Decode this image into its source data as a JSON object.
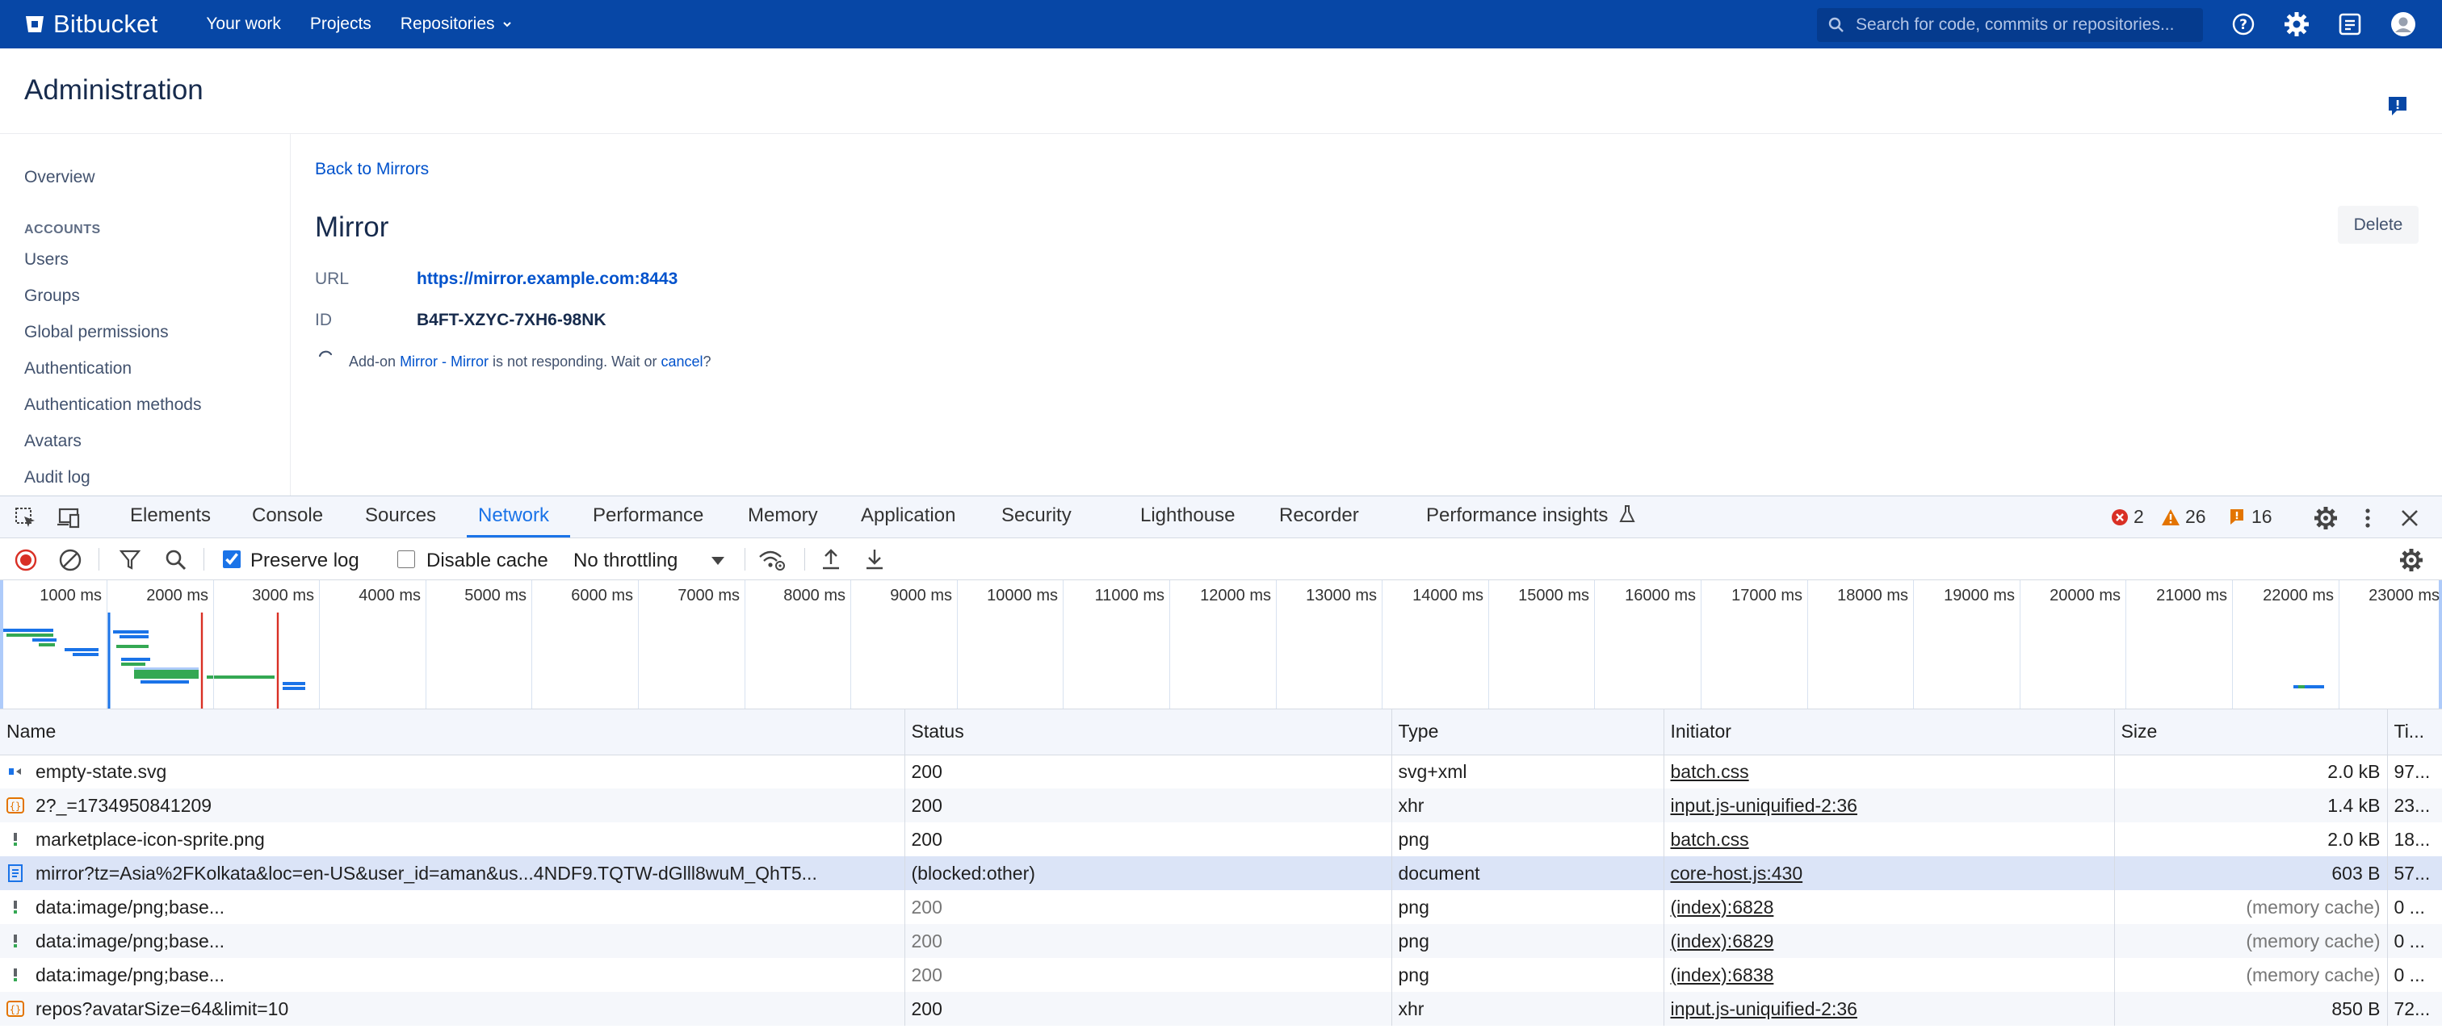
{
  "topnav": {
    "brand": "Bitbucket",
    "links": [
      "Your work",
      "Projects",
      "Repositories"
    ],
    "search_placeholder": "Search for code, commits or repositories..."
  },
  "admin": {
    "title": "Administration"
  },
  "sidebar": {
    "overview": "Overview",
    "accounts_heading": "ACCOUNTS",
    "items": [
      "Users",
      "Groups",
      "Global permissions",
      "Authentication",
      "Authentication methods",
      "Avatars",
      "Audit log"
    ]
  },
  "main": {
    "back_link": "Back to Mirrors",
    "title": "Mirror",
    "delete_label": "Delete",
    "url_label": "URL",
    "url_value": "https://mirror.example.com:8443",
    "id_label": "ID",
    "id_value": "B4FT-XZYC-7XH6-98NK",
    "addon_prefix": "Add-on",
    "addon_link": "Mirror - Mirror",
    "addon_middle": "is not responding. Wait or",
    "addon_cancel": "cancel",
    "addon_suffix": "?"
  },
  "devtools": {
    "tabs": [
      "Elements",
      "Console",
      "Sources",
      "Network",
      "Performance",
      "Memory",
      "Application",
      "Security",
      "Lighthouse",
      "Recorder",
      "Performance insights"
    ],
    "active_tab": "Network",
    "errors": "2",
    "warnings": "26",
    "issues": "16",
    "toolbar": {
      "preserve_log": "Preserve log",
      "preserve_log_checked": true,
      "disable_cache": "Disable cache",
      "disable_cache_checked": false,
      "throttling": "No throttling"
    },
    "timeline_ticks": [
      "1000 ms",
      "2000 ms",
      "3000 ms",
      "4000 ms",
      "5000 ms",
      "6000 ms",
      "7000 ms",
      "8000 ms",
      "9000 ms",
      "10000 ms",
      "11000 ms",
      "12000 ms",
      "13000 ms",
      "14000 ms",
      "15000 ms",
      "16000 ms",
      "17000 ms",
      "18000 ms",
      "19000 ms",
      "20000 ms",
      "21000 ms",
      "22000 ms",
      "23000 ms"
    ],
    "columns": [
      "Name",
      "Status",
      "Type",
      "Initiator",
      "Size",
      "Ti..."
    ],
    "rows": [
      {
        "icon": "svg",
        "name": "empty-state.svg",
        "status": "200",
        "type": "svg+xml",
        "initiator": "batch.css",
        "size": "2.0 kB",
        "time": "97..."
      },
      {
        "icon": "xhr",
        "name": "2?_=1734950841209",
        "status": "200",
        "type": "xhr",
        "initiator": "input.js-uniquified-2:36",
        "size": "1.4 kB",
        "time": "23..."
      },
      {
        "icon": "img",
        "name": "marketplace-icon-sprite.png",
        "status": "200",
        "type": "png",
        "initiator": "batch.css",
        "size": "2.0 kB",
        "time": "18..."
      },
      {
        "icon": "doc",
        "name": "mirror?tz=Asia%2FKolkata&loc=en-US&user_id=aman&us...4NDF9.TQTW-dGlll8wuM_QhT5...",
        "status": "(blocked:other)",
        "type": "document",
        "initiator": "core-host.js:430",
        "size": "603 B",
        "time": "57..."
      },
      {
        "icon": "img",
        "name": "data:image/png;base...",
        "status": "200",
        "type": "png",
        "initiator": "(index):6828",
        "size": "(memory cache)",
        "time": "0 ..."
      },
      {
        "icon": "img",
        "name": "data:image/png;base...",
        "status": "200",
        "type": "png",
        "initiator": "(index):6829",
        "size": "(memory cache)",
        "time": "0 ..."
      },
      {
        "icon": "img",
        "name": "data:image/png;base...",
        "status": "200",
        "type": "png",
        "initiator": "(index):6838",
        "size": "(memory cache)",
        "time": "0 ..."
      },
      {
        "icon": "xhr",
        "name": "repos?avatarSize=64&limit=10",
        "status": "200",
        "type": "xhr",
        "initiator": "input.js-uniquified-2:36",
        "size": "850 B",
        "time": "72..."
      }
    ]
  },
  "colors": {
    "nav_bg": "#0747a6",
    "link": "#0052cc",
    "devtools_active": "#1a73e8",
    "error": "#d93025",
    "warning": "#e37400"
  }
}
